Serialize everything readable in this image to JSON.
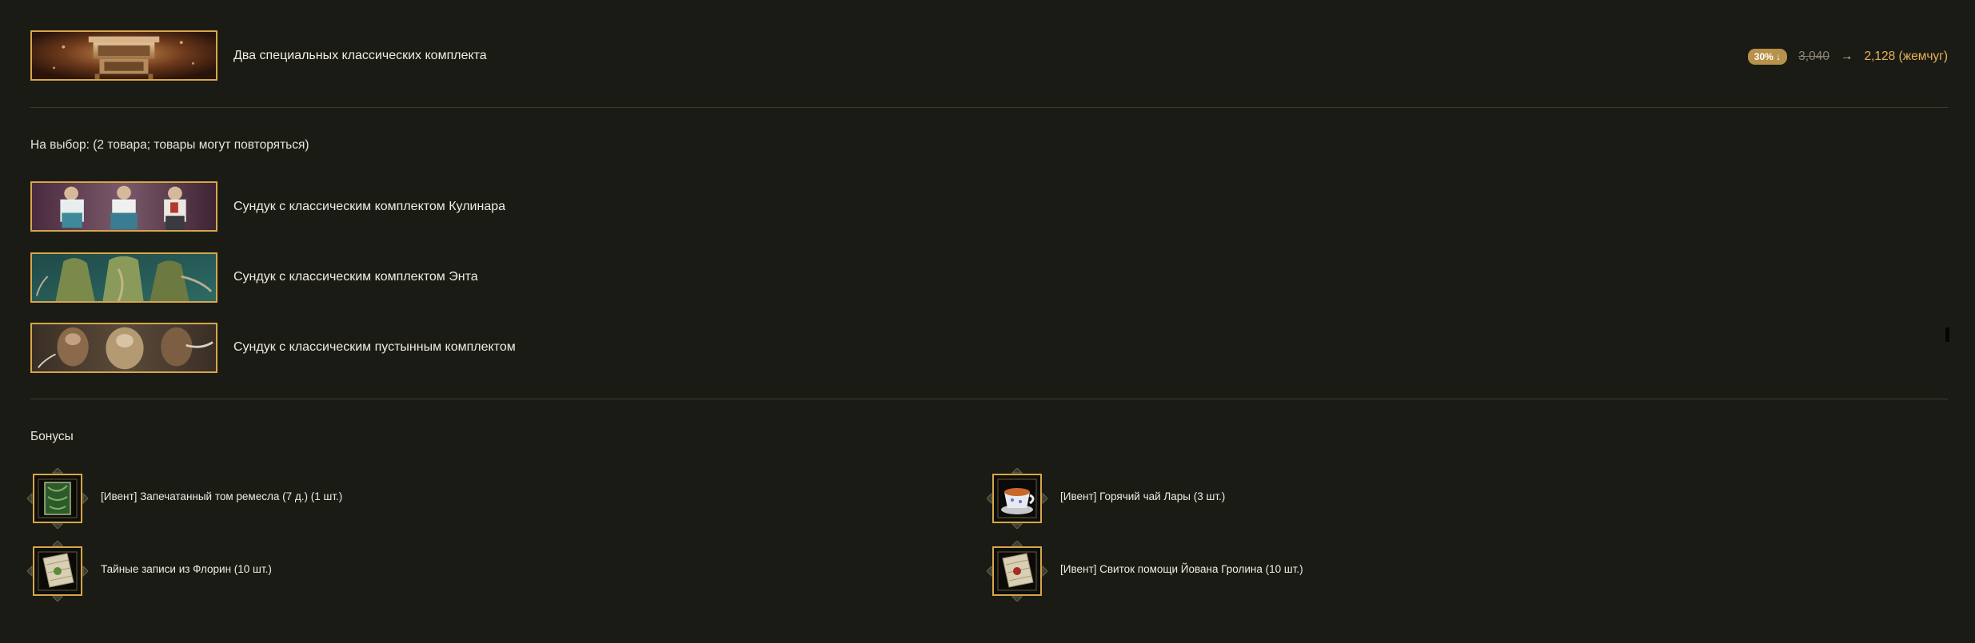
{
  "header_item": {
    "label": "Два специальных классических комплекта",
    "image": "vintage-cabinet-thumbnail"
  },
  "price": {
    "discount": "30% ↓",
    "old": "3,040",
    "arrow": "→",
    "new": "2,128 (жемчуг)"
  },
  "choice": {
    "title": "На выбор: (2 товара; товары могут повторяться)",
    "items": [
      {
        "label": "Сундук с классическим комплектом Кулинара",
        "image": "cook-outfit-thumbnail"
      },
      {
        "label": "Сундук с классическим комплектом Энта",
        "image": "ent-outfit-thumbnail"
      },
      {
        "label": "Сундук с классическим пустынным комплектом",
        "image": "desert-outfit-thumbnail"
      }
    ]
  },
  "bonuses": {
    "title": "Бонусы",
    "items": [
      {
        "label": "[Ивент] Запечатанный том ремесла (7 д.) (1 шт.)",
        "icon": "green-tome-icon"
      },
      {
        "label": "[Ивент] Горячий чай Лары (3 шт.)",
        "icon": "tea-cup-icon"
      },
      {
        "label": "Тайные записи из Флорин (10 шт.)",
        "icon": "sealed-letter-icon"
      },
      {
        "label": "[Ивент] Свиток помощи Йована Гролина (10 шт.)",
        "icon": "red-seal-letter-icon"
      }
    ]
  },
  "colors": {
    "background": "#1b1b15",
    "accent_gold": "#d6a64a",
    "price_new": "#e8b25a",
    "divider": "#3f3d33"
  }
}
